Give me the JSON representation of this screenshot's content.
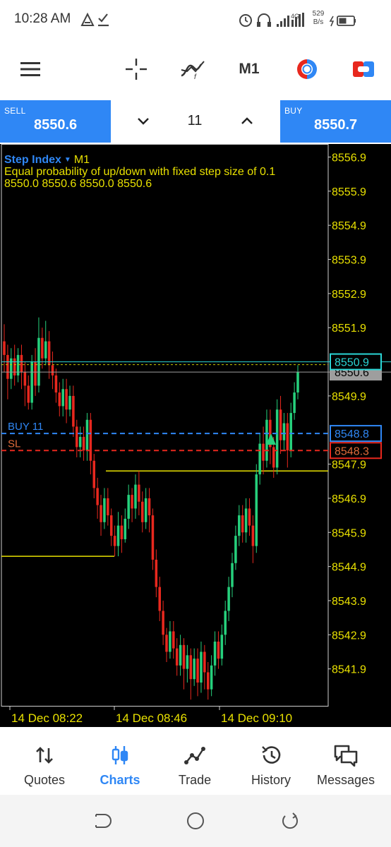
{
  "status_bar": {
    "time": "10:28 AM",
    "left_icons": [
      "navigation-icon",
      "download-done-icon"
    ],
    "right_icons": [
      "alarm-icon",
      "headset-icon",
      "signal-icon",
      "lte-icon",
      "battery-charging-icon"
    ],
    "net_speed_value": "529",
    "net_speed_unit": "B/s",
    "network_type": "4G"
  },
  "toolbar": {
    "timeframe": "M1",
    "icons": [
      "menu-icon",
      "crosshair-icon",
      "indicators-icon",
      "one-click-trading-icon",
      "trade-icon"
    ]
  },
  "trade_panel": {
    "sell_label": "SELL",
    "sell_price": "8550.6",
    "buy_label": "BUY",
    "buy_price": "8550.7",
    "volume": "11"
  },
  "chart_data": {
    "type": "candlestick",
    "symbol": "Step Index",
    "timeframe": "M1",
    "description": "Equal probability of up/down with fixed step size of 0.1",
    "ohlc_label": "8550.0 8550.6 8550.0 8550.6",
    "y_ticks": [
      "8556.9",
      "8555.9",
      "8554.9",
      "8553.9",
      "8552.9",
      "8551.9",
      "8549.9",
      "8547.9",
      "8546.9",
      "8545.9",
      "8544.9",
      "8543.9",
      "8542.9",
      "8541.9"
    ],
    "y_range": [
      8540.9,
      8557.2
    ],
    "x_labels": [
      "14 Dec 08:22",
      "14 Dec 08:46",
      "14 Dec 09:10"
    ],
    "price_tags": {
      "ask": "8550.9",
      "bid": "8550.6",
      "buy_position": "8548.8",
      "stop_loss": "8548.3"
    },
    "line_labels": {
      "buy": "BUY 11",
      "sl": "SL"
    },
    "levels": {
      "ask": 8550.9,
      "bid": 8550.6,
      "buy_position": 8548.8,
      "stop_loss": 8548.3,
      "support_upper": 8547.7,
      "support_lower": 8545.2
    },
    "colors": {
      "background": "#000000",
      "bull": "#26d07c",
      "bear": "#e8281e",
      "axis_text": "#e8e000",
      "ask": "#2bd6d6",
      "bid": "#9e9e9e",
      "buy_line": "#2f87f5",
      "sl_line": "#e8281e",
      "support": "#e8e000"
    },
    "grid": false,
    "candles": [
      [
        8551.5,
        8551.1,
        8552.0,
        8550.6
      ],
      [
        8551.1,
        8550.4,
        8551.4,
        8549.8
      ],
      [
        8550.4,
        8551.0,
        8551.3,
        8550.1
      ],
      [
        8551.0,
        8550.5,
        8551.4,
        8550.2
      ],
      [
        8550.5,
        8551.1,
        8551.3,
        8550.3
      ],
      [
        8551.1,
        8550.6,
        8551.4,
        8550.1
      ],
      [
        8550.6,
        8550.2,
        8550.9,
        8549.6
      ],
      [
        8550.2,
        8549.7,
        8550.5,
        8549.5
      ],
      [
        8549.7,
        8550.9,
        8551.1,
        8549.5
      ],
      [
        8550.9,
        8550.2,
        8551.3,
        8549.9
      ],
      [
        8550.2,
        8551.6,
        8552.2,
        8550.0
      ],
      [
        8551.6,
        8551.0,
        8551.9,
        8550.7
      ],
      [
        8551.0,
        8551.5,
        8552.1,
        8550.8
      ],
      [
        8551.5,
        8550.8,
        8551.8,
        8550.4
      ],
      [
        8550.8,
        8550.5,
        8551.2,
        8550.1
      ],
      [
        8550.5,
        8550.0,
        8550.7,
        8549.7
      ],
      [
        8550.0,
        8549.6,
        8550.3,
        8549.3
      ],
      [
        8549.6,
        8550.1,
        8550.4,
        8549.3
      ],
      [
        8550.1,
        8549.5,
        8550.4,
        8549.1
      ],
      [
        8549.5,
        8549.9,
        8550.2,
        8549.3
      ],
      [
        8549.9,
        8549.0,
        8550.2,
        8548.7
      ],
      [
        8549.0,
        8548.4,
        8549.2,
        8548.1
      ],
      [
        8548.4,
        8548.7,
        8549.0,
        8548.1
      ],
      [
        8548.7,
        8548.3,
        8549.0,
        8548.0
      ],
      [
        8548.3,
        8549.2,
        8549.4,
        8548.0
      ],
      [
        8549.2,
        8548.0,
        8549.4,
        8547.6
      ],
      [
        8548.0,
        8547.2,
        8548.2,
        8546.9
      ],
      [
        8547.2,
        8546.7,
        8547.5,
        8546.3
      ],
      [
        8546.7,
        8546.2,
        8547.0,
        8545.8
      ],
      [
        8546.2,
        8546.9,
        8547.2,
        8546.0
      ],
      [
        8546.9,
        8546.4,
        8547.2,
        8546.1
      ],
      [
        8546.4,
        8545.8,
        8546.6,
        8545.5
      ],
      [
        8545.8,
        8545.5,
        8546.1,
        8545.2
      ],
      [
        8545.5,
        8546.1,
        8546.5,
        8545.2
      ],
      [
        8546.1,
        8545.7,
        8546.4,
        8545.3
      ],
      [
        8545.7,
        8546.3,
        8546.6,
        8545.6
      ],
      [
        8546.3,
        8547.0,
        8547.3,
        8546.0
      ],
      [
        8547.0,
        8546.6,
        8547.2,
        8546.2
      ],
      [
        8546.6,
        8547.3,
        8547.6,
        8546.3
      ],
      [
        8547.3,
        8546.8,
        8547.7,
        8546.4
      ],
      [
        8546.8,
        8546.2,
        8547.1,
        8545.9
      ],
      [
        8546.2,
        8546.9,
        8547.2,
        8546.0
      ],
      [
        8546.9,
        8546.4,
        8547.2,
        8545.9
      ],
      [
        8546.4,
        8545.1,
        8546.6,
        8544.8
      ],
      [
        8545.1,
        8544.3,
        8545.4,
        8544.0
      ],
      [
        8544.3,
        8543.6,
        8544.6,
        8543.3
      ],
      [
        8543.6,
        8542.9,
        8543.9,
        8542.6
      ],
      [
        8542.9,
        8542.4,
        8543.1,
        8542.1
      ],
      [
        8542.4,
        8543.0,
        8543.3,
        8542.2
      ],
      [
        8543.0,
        8542.5,
        8543.3,
        8542.2
      ],
      [
        8542.5,
        8542.0,
        8542.8,
        8541.7
      ],
      [
        8542.0,
        8542.6,
        8542.9,
        8541.7
      ],
      [
        8542.6,
        8541.9,
        8542.8,
        8541.3
      ],
      [
        8541.9,
        8542.3,
        8542.6,
        8541.5
      ],
      [
        8542.3,
        8541.6,
        8542.5,
        8541.0
      ],
      [
        8541.6,
        8542.2,
        8542.5,
        8541.4
      ],
      [
        8542.2,
        8541.5,
        8542.5,
        8541.1
      ],
      [
        8541.5,
        8542.4,
        8542.7,
        8541.2
      ],
      [
        8542.4,
        8541.8,
        8542.6,
        8541.3
      ],
      [
        8541.8,
        8541.3,
        8542.1,
        8541.0
      ],
      [
        8541.3,
        8542.0,
        8542.3,
        8541.1
      ],
      [
        8542.0,
        8542.7,
        8543.0,
        8541.7
      ],
      [
        8542.7,
        8542.2,
        8543.0,
        8541.9
      ],
      [
        8542.2,
        8542.9,
        8543.2,
        8542.0
      ],
      [
        8542.9,
        8543.6,
        8543.9,
        8542.6
      ],
      [
        8543.6,
        8544.3,
        8544.6,
        8543.3
      ],
      [
        8544.3,
        8545.0,
        8545.3,
        8544.0
      ],
      [
        8545.0,
        8545.8,
        8546.1,
        8544.8
      ],
      [
        8545.8,
        8546.4,
        8546.7,
        8545.5
      ],
      [
        8546.4,
        8545.9,
        8546.7,
        8545.6
      ],
      [
        8545.9,
        8546.6,
        8546.9,
        8545.6
      ],
      [
        8546.6,
        8546.1,
        8546.9,
        8545.8
      ],
      [
        8546.1,
        8545.5,
        8546.4,
        8545.0
      ],
      [
        8545.5,
        8547.6,
        8547.9,
        8545.3
      ],
      [
        8547.6,
        8548.5,
        8548.8,
        8547.3
      ],
      [
        8548.5,
        8548.0,
        8549.0,
        8547.6
      ],
      [
        8548.0,
        8549.2,
        8549.5,
        8547.8
      ],
      [
        8549.2,
        8548.4,
        8549.5,
        8547.9
      ],
      [
        8548.4,
        8547.8,
        8548.7,
        8547.5
      ],
      [
        8547.8,
        8549.5,
        8549.8,
        8547.6
      ],
      [
        8549.5,
        8548.6,
        8549.9,
        8548.2
      ],
      [
        8548.6,
        8549.1,
        8549.4,
        8548.3
      ],
      [
        8549.1,
        8548.3,
        8549.4,
        8547.8
      ],
      [
        8548.3,
        8549.4,
        8549.7,
        8548.1
      ],
      [
        8549.4,
        8550.0,
        8550.3,
        8549.2
      ],
      [
        8550.0,
        8550.6,
        8550.8,
        8549.8
      ]
    ]
  },
  "bottom_nav": [
    {
      "label": "Quotes",
      "icon": "quotes-icon",
      "active": false
    },
    {
      "label": "Charts",
      "icon": "charts-icon",
      "active": true
    },
    {
      "label": "Trade",
      "icon": "trade-icon",
      "active": false
    },
    {
      "label": "History",
      "icon": "history-icon",
      "active": false
    },
    {
      "label": "Messages",
      "icon": "messages-icon",
      "active": false
    }
  ],
  "system_nav": [
    "back-icon",
    "home-icon",
    "recents-icon"
  ]
}
